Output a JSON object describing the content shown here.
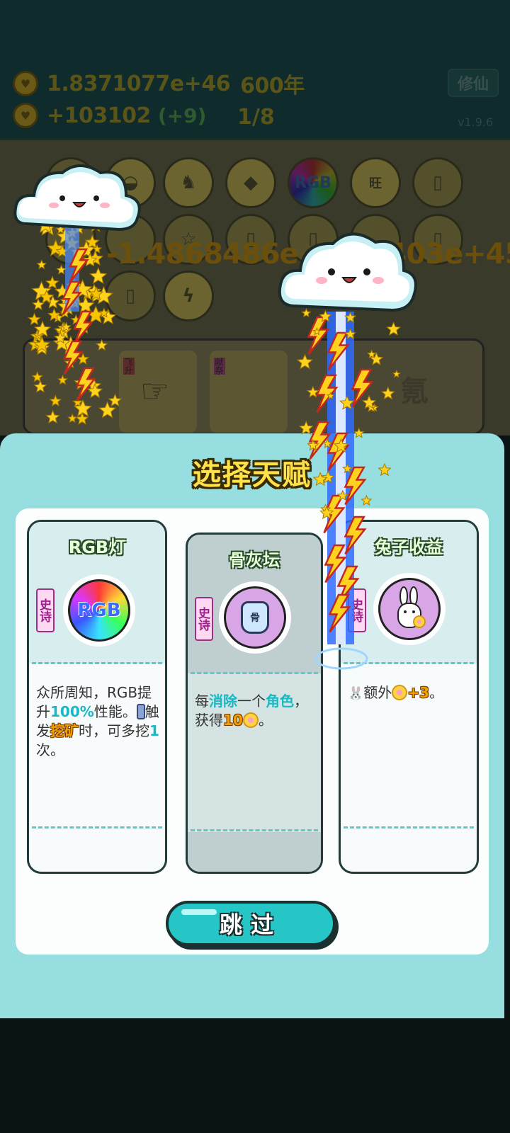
{
  "hud": {
    "gold_total": "1.8371077e+46",
    "years": "600年",
    "income": "+103102",
    "income_bonus": "(+9)",
    "wave": "1/8",
    "cultivate_label": "修仙",
    "version": "v1.9.6"
  },
  "board": {
    "floating_number": "-1.4868486e+46 7403e+45",
    "rgb_slot_label": "RGB",
    "wang_label": "旺",
    "skill_char": "氪",
    "skill_tag_1": "飞升",
    "skill_tag_2": "献祭"
  },
  "modal": {
    "title": "选择天赋",
    "skip_label": "跳过",
    "cards": [
      {
        "name": "RGB灯",
        "rarity": "史诗",
        "icon": "rgb-light-icon",
        "icon_text": "RGB",
        "desc_parts": [
          "众所周知，RGB提升",
          "100%",
          "性能。",
          "触发",
          "挖矿",
          "时，可多挖",
          "1",
          "次。"
        ]
      },
      {
        "name": "骨灰坛",
        "rarity": "史诗",
        "icon": "urn-icon",
        "icon_text": "骨",
        "desc_parts": [
          "每",
          "消除",
          "一个",
          "角色",
          "，获得",
          "10",
          "。"
        ]
      },
      {
        "name": "兔子收益",
        "rarity": "史诗",
        "icon": "rabbit-icon",
        "desc_parts": [
          "额外",
          "+3",
          "。"
        ]
      }
    ]
  },
  "colors": {
    "modal_bg": "#96dedf",
    "accent": "#27c6c6",
    "title_yellow": "#ffe24a",
    "rarity_purple": "#a01f8a"
  }
}
